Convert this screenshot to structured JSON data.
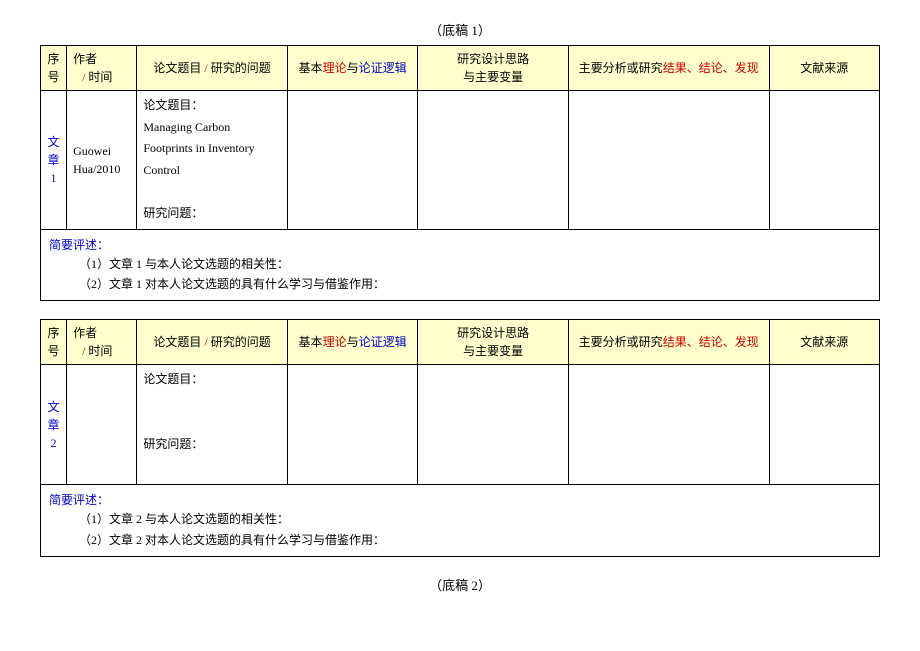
{
  "titles": {
    "top": "（底稿 1）",
    "bottom": "（底稿 2）"
  },
  "headers": {
    "idx_a": "序",
    "idx_b": "号",
    "author_a": "作者",
    "author_slash": " / ",
    "author_b": "时间",
    "topic_a": "论文题目",
    "topic_slash": " / ",
    "topic_b": "研究的问题",
    "theory_a": "基本",
    "theory_red": "理论",
    "theory_b": "与",
    "theory_blue": "论证逻辑",
    "design_a": "研究设计思路",
    "design_b": "与主要变量",
    "analysis_a": "主要分析或研究",
    "analysis_red": "结果、结论、发现",
    "source": "文献来源"
  },
  "labels": {
    "topic_label": "论文题目：",
    "question_label": "研究问题：",
    "review_label": "简要评述："
  },
  "article1": {
    "idx1": "文",
    "idx2": "章",
    "idx3": "1",
    "author": "Guowei Hua/2010",
    "title": "Managing Carbon Footprints in Inventory Control",
    "review1": "（1）文章 1 与本人论文选题的相关性：",
    "review2": "（2）文章 1 对本人论文选题的具有什么学习与借鉴作用："
  },
  "article2": {
    "idx1": "文",
    "idx2": "章",
    "idx3": "2",
    "author": "",
    "title": "",
    "review1": "（1）文章 2 与本人论文选题的相关性：",
    "review2": "（2）文章 2 对本人论文选题的具有什么学习与借鉴作用："
  }
}
